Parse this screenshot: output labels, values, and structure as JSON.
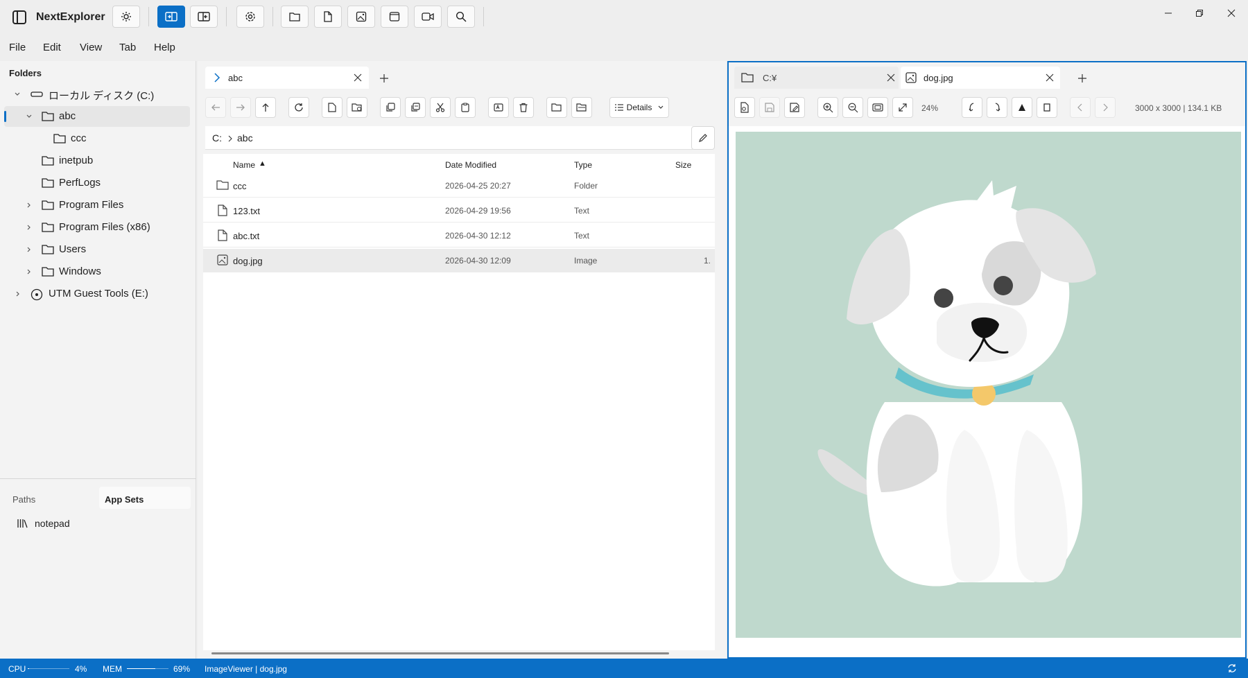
{
  "app": {
    "title": "NextExplorer"
  },
  "menu": [
    "File",
    "Edit",
    "View",
    "Tab",
    "Help"
  ],
  "toolbar_icons": [
    "sidebar-icon",
    "theme-icon",
    "single-pane-icon",
    "dual-pane-icon",
    "settings-icon",
    "folder-icon",
    "file-icon",
    "image-icon",
    "window-icon",
    "video-icon",
    "search-icon"
  ],
  "sidebar": {
    "header": "Folders",
    "tree": [
      {
        "label": "ローカル ディスク (C:)",
        "icon": "drive-icon"
      },
      {
        "label": "abc",
        "icon": "folder-icon"
      },
      {
        "label": "ccc",
        "icon": "folder-icon"
      },
      {
        "label": "inetpub",
        "icon": "folder-icon"
      },
      {
        "label": "PerfLogs",
        "icon": "folder-icon"
      },
      {
        "label": "Program Files",
        "icon": "folder-icon"
      },
      {
        "label": "Program Files (x86)",
        "icon": "folder-icon"
      },
      {
        "label": "Users",
        "icon": "folder-icon"
      },
      {
        "label": "Windows",
        "icon": "folder-icon"
      },
      {
        "label": "UTM Guest Tools (E:)",
        "icon": "disc-icon"
      }
    ],
    "bottom_tabs": [
      "Paths",
      "App Sets"
    ],
    "app_sets": [
      {
        "label": "notepad",
        "icon": "library-icon"
      }
    ]
  },
  "left_pane": {
    "tab_title": "abc",
    "view_mode": "Details",
    "path": [
      "C:",
      "abc"
    ],
    "columns": {
      "name": "Name",
      "date": "Date Modified",
      "type": "Type",
      "size": "Size"
    },
    "sort_indicator": "▲",
    "rows": [
      {
        "name": "ccc",
        "date": "2026-04-25 20:27",
        "type": "Folder",
        "size": "",
        "icon": "folder-icon"
      },
      {
        "name": "123.txt",
        "date": "2026-04-29 19:56",
        "type": "Text",
        "size": "",
        "icon": "file-icon"
      },
      {
        "name": "abc.txt",
        "date": "2026-04-30 12:12",
        "type": "Text",
        "size": "",
        "icon": "file-icon"
      },
      {
        "name": "dog.jpg",
        "date": "2026-04-30 12:09",
        "type": "Image",
        "size": "1.",
        "icon": "image-icon"
      }
    ]
  },
  "right_pane": {
    "tabs": [
      "C:¥",
      "dog.jpg"
    ],
    "zoom": "24%",
    "image_info": "3000 x 3000 | 134.1 KB",
    "image_bg": "#bfd9cd"
  },
  "status": {
    "cpu_label": "CPU",
    "cpu_value": "4%",
    "cpu_level": 0.04,
    "mem_label": "MEM",
    "mem_value": "69%",
    "mem_level": 0.69,
    "viewer_text": "ImageViewer | dog.jpg"
  },
  "colors": {
    "accent": "#0b6fc6"
  }
}
